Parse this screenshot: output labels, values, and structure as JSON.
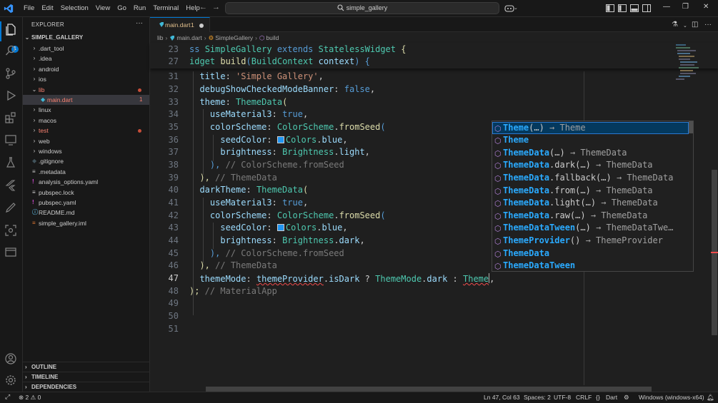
{
  "menu": [
    "File",
    "Edit",
    "Selection",
    "View",
    "Go",
    "Run",
    "Terminal",
    "Help"
  ],
  "search": {
    "text": "simple_gallery"
  },
  "activity_badge": "1",
  "sidebar": {
    "title": "EXPLORER",
    "root": "SIMPLE_GALLERY",
    "items": [
      {
        "label": ".dart_tool",
        "kind": "folder"
      },
      {
        "label": ".idea",
        "kind": "folder"
      },
      {
        "label": "android",
        "kind": "folder"
      },
      {
        "label": "ios",
        "kind": "folder"
      },
      {
        "label": "lib",
        "kind": "folder-open",
        "error": true
      },
      {
        "label": "main.dart",
        "kind": "dart",
        "count": "1"
      },
      {
        "label": "linux",
        "kind": "folder"
      },
      {
        "label": "macos",
        "kind": "folder"
      },
      {
        "label": "test",
        "kind": "folder",
        "error": true
      },
      {
        "label": "web",
        "kind": "folder"
      },
      {
        "label": "windows",
        "kind": "folder"
      },
      {
        "label": ".gitignore",
        "kind": "git"
      },
      {
        "label": ".metadata",
        "kind": "meta"
      },
      {
        "label": "analysis_options.yaml",
        "kind": "yaml"
      },
      {
        "label": "pubspec.lock",
        "kind": "lock"
      },
      {
        "label": "pubspec.yaml",
        "kind": "yaml"
      },
      {
        "label": "README.md",
        "kind": "info"
      },
      {
        "label": "simple_gallery.iml",
        "kind": "iml"
      }
    ],
    "sections": [
      "OUTLINE",
      "TIMELINE",
      "DEPENDENCIES"
    ]
  },
  "tab": {
    "name": "main.dart",
    "problems": "1"
  },
  "breadcrumb": [
    "lib",
    "main.dart",
    "SimpleGallery",
    "build"
  ],
  "code": {
    "line_numbers": [
      "23",
      "27",
      "31",
      "32",
      "33",
      "34",
      "35",
      "36",
      "37",
      "38",
      "39",
      "40",
      "41",
      "42",
      "43",
      "44",
      "45",
      "46",
      "47",
      "48",
      "49",
      "50",
      "51"
    ],
    "sticky1": {
      "kw": "ss ",
      "cls": "SimpleGallery",
      "ext": " extends ",
      "base": "StatelessWidget",
      "brace": " {"
    },
    "sticky2": {
      "pre": "idget ",
      "fn": "build",
      "open": "(",
      "type": "BuildContext",
      "sp": " ",
      "param": "context",
      "close": ") {"
    },
    "l31": {
      "prop": "title",
      "colon": ": ",
      "str": "'Simple Gallery'",
      "end": ","
    },
    "l32": {
      "prop": "debugShowCheckedModeBanner",
      "colon": ": ",
      "val": "false",
      "end": ","
    },
    "l33": {
      "prop": "theme",
      "colon": ": ",
      "type": "ThemeData",
      "end": "("
    },
    "l34": {
      "prop": "useMaterial3",
      "colon": ": ",
      "val": "true",
      "end": ","
    },
    "l35": {
      "prop": "colorScheme",
      "colon": ": ",
      "type": "ColorScheme",
      "dot": ".",
      "fn": "fromSeed",
      "end": "("
    },
    "l36": {
      "prop": "seedColor",
      "colon": ": ",
      "type": "Colors",
      "dot": ".",
      "val": "blue",
      "end": ","
    },
    "l37": {
      "prop": "brightness",
      "colon": ": ",
      "type": "Brightness",
      "dot": ".",
      "val": "light",
      "end": ","
    },
    "l38": {
      "close": "), ",
      "comment": "// ColorScheme.fromSeed"
    },
    "l39": {
      "close": "), ",
      "comment": "// ThemeData"
    },
    "l40": {
      "prop": "darkTheme",
      "colon": ": ",
      "type": "ThemeData",
      "end": "("
    },
    "l41": {
      "prop": "useMaterial3",
      "colon": ": ",
      "val": "true",
      "end": ","
    },
    "l42": {
      "prop": "colorScheme",
      "colon": ": ",
      "type": "ColorScheme",
      "dot": ".",
      "fn": "fromSeed",
      "end": "("
    },
    "l43": {
      "prop": "seedColor",
      "colon": ": ",
      "type": "Colors",
      "dot": ".",
      "val": "blue",
      "end": ","
    },
    "l44": {
      "prop": "brightness",
      "colon": ": ",
      "type": "Brightness",
      "dot": ".",
      "val": "dark",
      "end": ","
    },
    "l45": {
      "close": "), ",
      "comment": "// ColorScheme.fromSeed"
    },
    "l46": {
      "close": "), ",
      "comment": "// ThemeData"
    },
    "l47": {
      "prop": "themeMode",
      "colon": ": ",
      "var": "themeProvider",
      "dot": ".",
      "field": "isDark",
      "q": " ? ",
      "type": "ThemeMode",
      "dot2": ".",
      "val": "dark",
      "c": " : ",
      "typed": "Theme",
      "end": ","
    },
    "l48": {
      "close": ");",
      "comment": " // MaterialApp"
    }
  },
  "suggest": [
    {
      "hl": "Theme",
      "rest": "(…)",
      "detail": " → Theme",
      "selected": true
    },
    {
      "hl": "Theme",
      "rest": "",
      "detail": ""
    },
    {
      "hl": "ThemeData",
      "rest": "(…)",
      "detail": " → ThemeData"
    },
    {
      "hl": "ThemeData",
      "rest": ".dark(…)",
      "detail": " → ThemeData"
    },
    {
      "hl": "ThemeData",
      "rest": ".fallback(…)",
      "detail": " → ThemeData"
    },
    {
      "hl": "ThemeData",
      "rest": ".from(…)",
      "detail": " → ThemeData"
    },
    {
      "hl": "ThemeData",
      "rest": ".light(…)",
      "detail": " → ThemeData"
    },
    {
      "hl": "ThemeData",
      "rest": ".raw(…)",
      "detail": " → ThemeData"
    },
    {
      "hl": "ThemeDataTween",
      "rest": "(…)",
      "detail": " → ThemeDataTwe…"
    },
    {
      "hl": "ThemeProvider",
      "rest": "()",
      "detail": " → ThemeProvider"
    },
    {
      "hl": "ThemeData",
      "rest": "",
      "detail": ""
    },
    {
      "hl": "ThemeDataTween",
      "rest": "",
      "detail": ""
    }
  ],
  "status": {
    "errors": "2",
    "warnings": "0",
    "position": "Ln 47, Col 63",
    "spaces": "Spaces: 2",
    "encoding": "UTF-8",
    "eol": "CRLF",
    "language": "Dart",
    "platform": "Windows (windows-x64)"
  },
  "colors": {
    "accent": "#0078d4",
    "error": "#f14c4c",
    "selection": "#04395e"
  }
}
